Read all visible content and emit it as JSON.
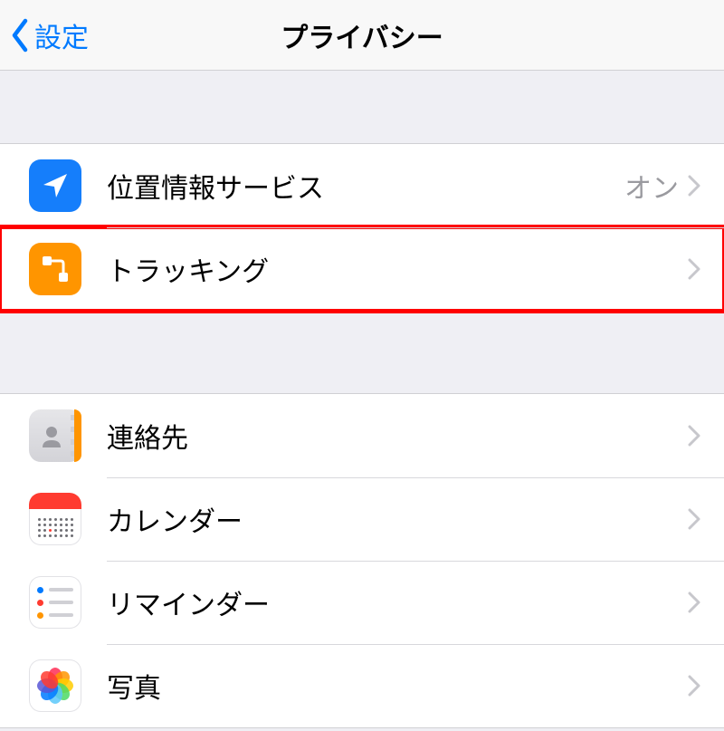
{
  "nav": {
    "back_label": "設定",
    "title": "プライバシー"
  },
  "groups": [
    {
      "rows": [
        {
          "id": "location",
          "label": "位置情報サービス",
          "value": "オン",
          "highlight": false
        },
        {
          "id": "tracking",
          "label": "トラッキング",
          "value": null,
          "highlight": true
        }
      ]
    },
    {
      "rows": [
        {
          "id": "contacts",
          "label": "連絡先",
          "value": null,
          "highlight": false
        },
        {
          "id": "calendar",
          "label": "カレンダー",
          "value": null,
          "highlight": false
        },
        {
          "id": "reminders",
          "label": "リマインダー",
          "value": null,
          "highlight": false
        },
        {
          "id": "photos",
          "label": "写真",
          "value": null,
          "highlight": false
        }
      ]
    }
  ],
  "colors": {
    "accent": "#007aff",
    "highlight": "#ff0000",
    "petals": [
      "#ff2d55",
      "#ff9500",
      "#ffcc00",
      "#4cd964",
      "#5ac8fa",
      "#007aff",
      "#5856d6",
      "#ff3b30"
    ]
  }
}
